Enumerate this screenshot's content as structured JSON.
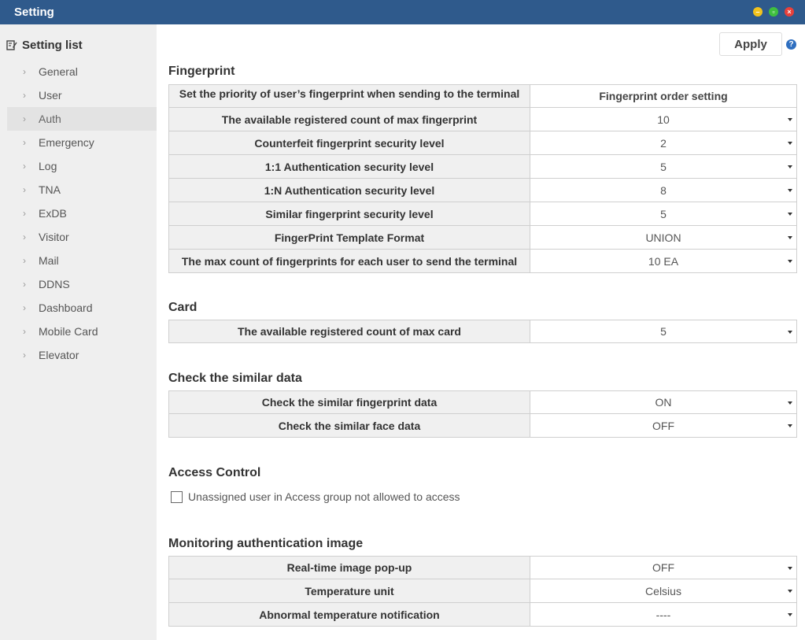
{
  "window": {
    "title": "Setting"
  },
  "sidebar": {
    "header": "Setting list",
    "items": [
      {
        "label": "General"
      },
      {
        "label": "User"
      },
      {
        "label": "Auth"
      },
      {
        "label": "Emergency"
      },
      {
        "label": "Log"
      },
      {
        "label": "TNA"
      },
      {
        "label": "ExDB"
      },
      {
        "label": "Visitor"
      },
      {
        "label": "Mail"
      },
      {
        "label": "DDNS"
      },
      {
        "label": "Dashboard"
      },
      {
        "label": "Mobile Card"
      },
      {
        "label": "Elevator"
      }
    ],
    "active": "Auth"
  },
  "toolbar": {
    "apply_label": "Apply",
    "help_label": "?"
  },
  "fingerprint": {
    "title": "Fingerprint",
    "rows": [
      {
        "label": "Set the priority of user’s fingerprint when sending to the terminal",
        "value": "Fingerprint order setting"
      },
      {
        "label": "The available registered count of max fingerprint",
        "value": "10"
      },
      {
        "label": "Counterfeit fingerprint security level",
        "value": "2"
      },
      {
        "label": "1:1 Authentication security level",
        "value": "5"
      },
      {
        "label": "1:N Authentication security level",
        "value": "8"
      },
      {
        "label": "Similar fingerprint security level",
        "value": "5"
      },
      {
        "label": "FingerPrint Template Format",
        "value": "UNION"
      },
      {
        "label": "The max count of fingerprints for each user to send the terminal",
        "value": "10 EA"
      }
    ]
  },
  "card": {
    "title": "Card",
    "rows": [
      {
        "label": "The available registered count of max card",
        "value": "5"
      }
    ]
  },
  "similar": {
    "title": "Check the similar data",
    "rows": [
      {
        "label": "Check the similar fingerprint data",
        "value": "ON"
      },
      {
        "label": "Check the similar face data",
        "value": "OFF"
      }
    ]
  },
  "access": {
    "title": "Access Control",
    "checkbox_label": "Unassigned user in Access group not allowed to access",
    "checked": false
  },
  "monitoring": {
    "title": "Monitoring authentication image",
    "rows": [
      {
        "label": "Real-time image pop-up",
        "value": "OFF"
      },
      {
        "label": "Temperature unit",
        "value": "Celsius"
      },
      {
        "label": "Abnormal temperature notification",
        "value": "----"
      }
    ]
  },
  "colors": {
    "titlebar": "#2f5a8c",
    "sidebar_bg": "#efefef",
    "label_bg": "#f0f0f0",
    "help": "#2f6fc0"
  }
}
